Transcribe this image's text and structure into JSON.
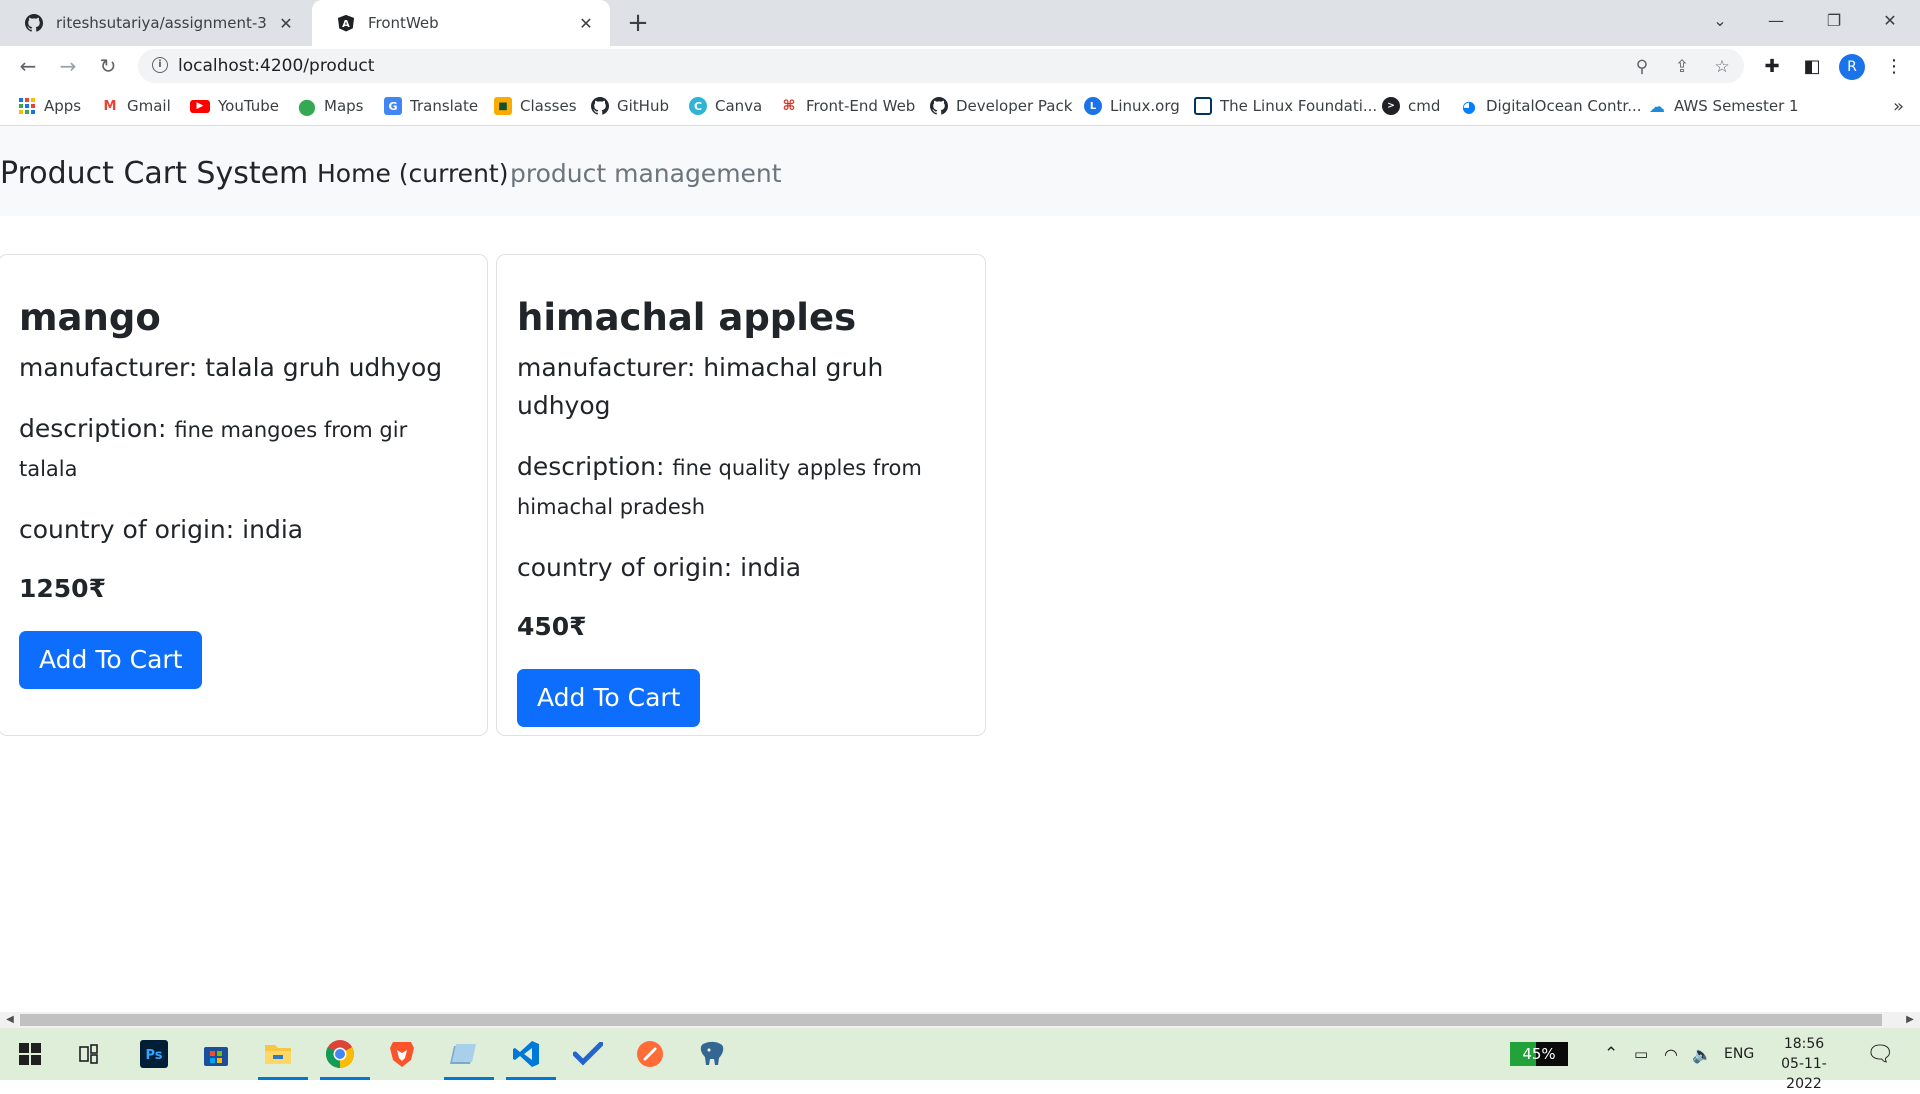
{
  "browser": {
    "tabs": [
      {
        "title": "riteshsutariya/assignment-3",
        "icon": "github-icon"
      },
      {
        "title": "FrontWeb",
        "icon": "angular-icon"
      }
    ],
    "url": "localhost:4200/product",
    "profile_initial": "R",
    "bookmarks": [
      {
        "label": "Apps",
        "icon": "apps-grid-icon"
      },
      {
        "label": "Gmail",
        "icon": "gmail-icon"
      },
      {
        "label": "YouTube",
        "icon": "youtube-icon"
      },
      {
        "label": "Maps",
        "icon": "maps-icon"
      },
      {
        "label": "Translate",
        "icon": "translate-icon"
      },
      {
        "label": "Classes",
        "icon": "classroom-icon"
      },
      {
        "label": "GitHub",
        "icon": "github-icon"
      },
      {
        "label": "Canva",
        "icon": "canva-icon"
      },
      {
        "label": "Front-End Web",
        "icon": "frontend-icon"
      },
      {
        "label": "Developer Pack",
        "icon": "github-icon"
      },
      {
        "label": "Linux.org",
        "icon": "linux-org-icon"
      },
      {
        "label": "The Linux Foundati...",
        "icon": "linux-foundation-icon"
      },
      {
        "label": "cmd",
        "icon": "cmd-icon"
      },
      {
        "label": "DigitalOcean Contr...",
        "icon": "digitalocean-icon"
      },
      {
        "label": "AWS Semester 1",
        "icon": "cloud-icon"
      }
    ]
  },
  "page": {
    "brand": "Product Cart System",
    "nav": {
      "home": "Home (current)",
      "management": "product management"
    },
    "products": [
      {
        "name": "mango",
        "manufacturer_label": "manufacturer: ",
        "manufacturer": "talala gruh udhyog",
        "description_label": "description: ",
        "description": "fine mangoes from gir talala",
        "origin_label": "country of origin: ",
        "origin": "india",
        "price": "1250₹",
        "button": "Add To Cart"
      },
      {
        "name": "himachal apples",
        "manufacturer_label": "manufacturer: ",
        "manufacturer": "himachal gruh udhyog",
        "description_label": "description: ",
        "description": "fine quality apples from himachal pradesh",
        "origin_label": "country of origin: ",
        "origin": "india",
        "price": "450₹",
        "button": "Add To Cart"
      }
    ]
  },
  "taskbar": {
    "battery": "45%",
    "battery_level": 0.45,
    "language": "ENG",
    "time": "18:56",
    "date": "05-11-2022"
  },
  "colors": {
    "primary_button": "#0d6efd",
    "navbar_bg": "#f8f9fa",
    "taskbar_bg": "#dfeed9"
  }
}
